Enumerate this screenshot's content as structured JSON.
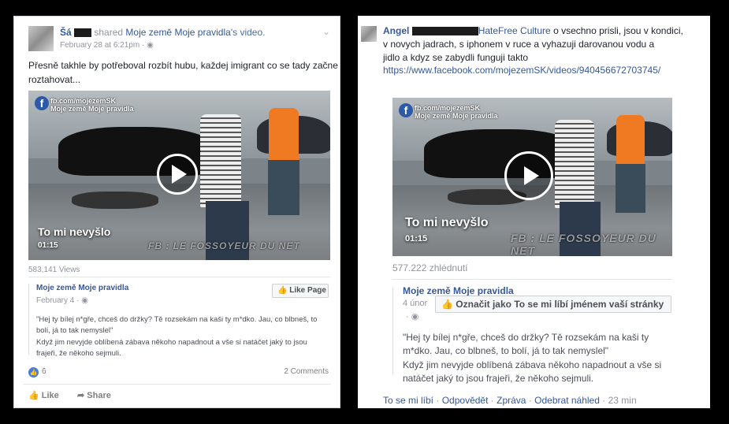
{
  "left": {
    "author_name": "Šá",
    "shared_text": "shared",
    "page_name": "Moje země Moje pravidla",
    "shared_suffix": "'s video.",
    "timestamp": "February 28 at 6:21pm",
    "post_text_line1": "Přesně takhle by potřeboval rozbít hubu, každej imigrant co se tady začne",
    "post_text_line2": "roztahovat...",
    "video": {
      "watermark_site": "fb.com/mojezemSK",
      "watermark_name": "Moje země Moje pravidla",
      "title": "To mi nevyšlo",
      "duration": "01:15",
      "bottom_watermark": "FB : LE FOSSOYEUR DU NET"
    },
    "views": "583,141 Views",
    "shared_page_name": "Moje země Moje pravidla",
    "shared_date": "February 4",
    "like_page_label": "Like Page",
    "quote_line1": "\"Hej ty bílej n*gře, chceš do držky? Tě rozsekám na kaši ty m*dko. Jau, co blbneš, to",
    "quote_line2": "bolí, já to tak nemyslel\"",
    "quote_line3": "Když jim nevyjde oblíbená zábava někoho napadnout a vše si natáčet jaký to jsou",
    "quote_line4": "frajeři, že někoho sejmuli.",
    "like_count": "6",
    "comments_count": "2 Comments",
    "like_action": "Like",
    "share_action": "Share"
  },
  "right": {
    "author_name": "Angel",
    "tagged_page": "HateFree Culture",
    "comment_line1": "o vsechno prisli, jsou v kondici,",
    "comment_line2": "v novych jadrach, s iphonem v ruce a vyhazuji darovanou vodu a",
    "comment_line3": "jidlo a kdyz se zabydli funguji takto",
    "link_url": "https://www.facebook.com/mojezemSK/videos/940456672703745/",
    "video": {
      "watermark_site": "fb.com/mojezemSK",
      "watermark_name": "Moje země Moje pravidla",
      "title": "To mi nevyšlo",
      "duration": "01:15",
      "bottom_watermark": "FB : LE FOSSOYEUR DU NET"
    },
    "views": "577.222 zhlédnutí",
    "shared_page_name": "Moje země Moje pravidla",
    "shared_date": "4 únor",
    "like_page_label": "Označit jako To se mi líbí jménem vaší stránky",
    "quote_line1": "\"Hej ty bílej n*gře, chceš do držky? Tě rozsekám na kaši ty",
    "quote_line2": "m*dko. Jau, co blbneš, to bolí, já to tak nemyslel\"",
    "quote_line3": "Když jim nevyjde oblíbená zábava někoho napadnout a vše si",
    "quote_line4": "natáčet jaký to jsou frajeři, že někoho sejmuli.",
    "action_like": "To se mi líbí",
    "action_reply": "Odpovědět",
    "action_message": "Zpráva",
    "action_remove_preview": "Odebrat náhled",
    "time_ago": "23 min",
    "separator": "·"
  }
}
